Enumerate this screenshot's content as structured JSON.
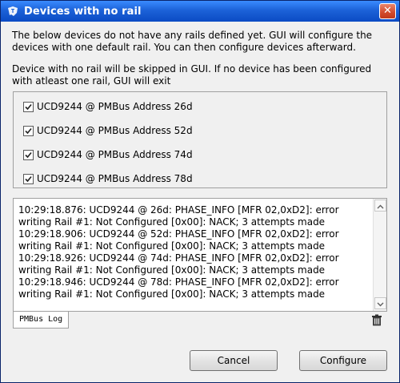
{
  "window": {
    "title": "Devices with no rail",
    "close_glyph": "✕"
  },
  "description": {
    "line1": "The below devices do not have any rails defined yet. GUI will configure the devices with one default rail. You can then configure devices afterward.",
    "line2": "Device with no rail will be skipped in GUI. If no device has been configured with atleast one rail, GUI will exit"
  },
  "devices": [
    {
      "label": "UCD9244 @ PMBus Address 26d",
      "checked": true
    },
    {
      "label": "UCD9244 @ PMBus Address 52d",
      "checked": true
    },
    {
      "label": "UCD9244 @ PMBus Address 74d",
      "checked": true
    },
    {
      "label": "UCD9244 @ PMBus Address 78d",
      "checked": true
    }
  ],
  "log": {
    "text": "10:29:18.876: UCD9244 @ 26d: PHASE_INFO [MFR 02,0xD2]: error writing Rail #1: Not Configured [0x00]: NACK; 3 attempts made\n10:29:18.906: UCD9244 @ 52d: PHASE_INFO [MFR 02,0xD2]: error writing Rail #1: Not Configured [0x00]: NACK; 3 attempts made\n10:29:18.926: UCD9244 @ 74d: PHASE_INFO [MFR 02,0xD2]: error writing Rail #1: Not Configured [0x00]: NACK; 3 attempts made\n10:29:18.946: UCD9244 @ 78d: PHASE_INFO [MFR 02,0xD2]: error writing Rail #1: Not Configured [0x00]: NACK; 3 attempts made",
    "tab_label": "PMBus Log"
  },
  "icons": {
    "app_icon": "ti-logo-icon",
    "clear_log": "trash-icon",
    "scroll_up": "arrow-up-icon",
    "scroll_down": "arrow-down-icon"
  },
  "colors": {
    "titlebar": "#1c62d8",
    "close_button": "#d2492b",
    "dialog_background": "#f0f0f0"
  },
  "buttons": {
    "cancel_label": "Cancel",
    "configure_label": "Configure"
  }
}
